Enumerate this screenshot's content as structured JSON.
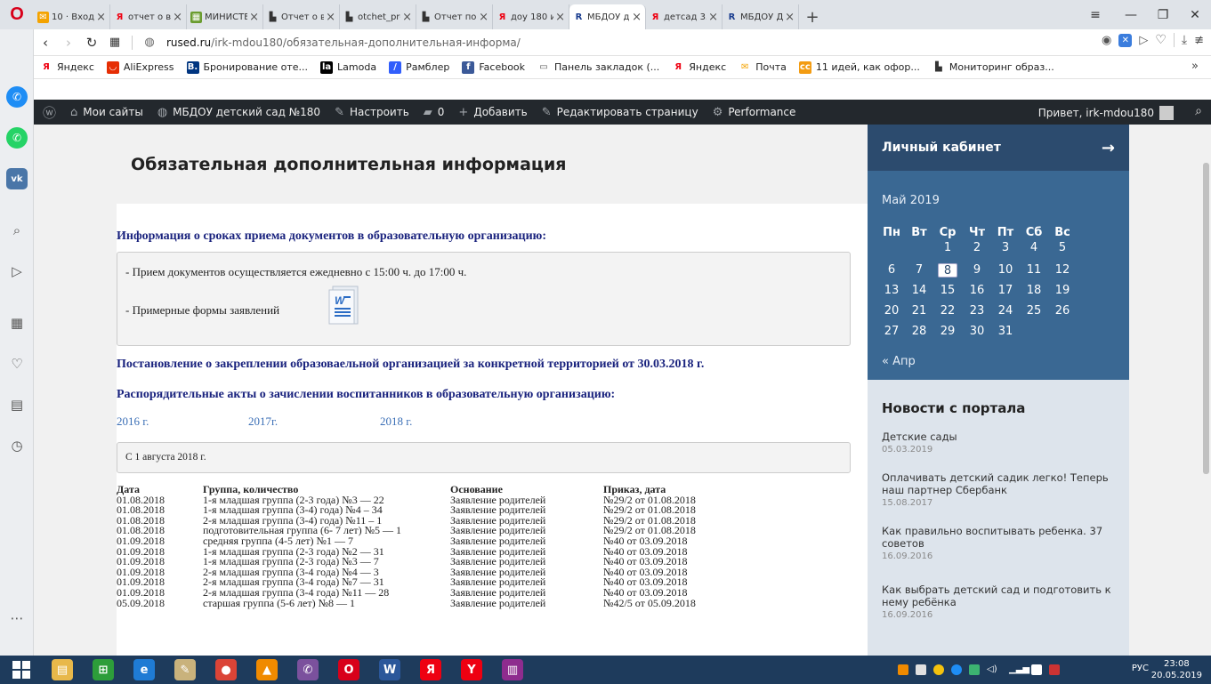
{
  "browser": {
    "logo": "O",
    "tabs": [
      {
        "title": "10 · Входя",
        "fav": "✉",
        "favColor": "#f4a300",
        "favText": "#fff"
      },
      {
        "title": "отчет о вь",
        "fav": "Я",
        "favColor": "transparent",
        "favText": "#e01"
      },
      {
        "title": "МИНИСТЕ",
        "fav": "▦",
        "favColor": "#6a9c2f",
        "favText": "#fff"
      },
      {
        "title": "Отчет о вь",
        "fav": "▙",
        "favColor": "transparent",
        "favText": "#333"
      },
      {
        "title": "otchet_pre",
        "fav": "▙",
        "favColor": "transparent",
        "favText": "#333"
      },
      {
        "title": "Отчет по",
        "fav": "▙",
        "favColor": "transparent",
        "favText": "#333"
      },
      {
        "title": "доу 180 и",
        "fav": "Я",
        "favColor": "transparent",
        "favText": "#e01"
      },
      {
        "title": "МБДОУ д",
        "fav": "R",
        "favColor": "transparent",
        "favText": "#1a3d8f"
      },
      {
        "title": "детсад 33",
        "fav": "Я",
        "favColor": "transparent",
        "favText": "#e01"
      },
      {
        "title": "МБДОУ Д",
        "fav": "R",
        "favColor": "transparent",
        "favText": "#1a3d8f"
      }
    ],
    "active_tab": 7,
    "new_tab": "+",
    "url_domain": "rused.ru",
    "url_path": "/irk-mdou180/обязательная-дополнительная-информа/",
    "bookmarks": [
      {
        "label": "Яндекс",
        "icon": "Я",
        "color": "#fff",
        "text": "#e01"
      },
      {
        "label": "AliExpress",
        "icon": "◡",
        "color": "#e62e04",
        "text": "#fff"
      },
      {
        "label": "Бронирование оте...",
        "icon": "B.",
        "color": "#003580",
        "text": "#fff"
      },
      {
        "label": "Lamoda",
        "icon": "la",
        "color": "#000",
        "text": "#fff"
      },
      {
        "label": "Рамблер",
        "icon": "/",
        "color": "#315efb",
        "text": "#fff"
      },
      {
        "label": "Facebook",
        "icon": "f",
        "color": "#3b5998",
        "text": "#fff"
      },
      {
        "label": "Панель закладок (...",
        "icon": "▭",
        "color": "#fff",
        "text": "#555"
      },
      {
        "label": "Яндекс",
        "icon": "Я",
        "color": "#fff",
        "text": "#e01"
      },
      {
        "label": "Почта",
        "icon": "✉",
        "color": "#fff",
        "text": "#f4a300"
      },
      {
        "label": "11 идей, как офор...",
        "icon": "cc",
        "color": "#f39c12",
        "text": "#fff"
      },
      {
        "label": "Мониторинг образ...",
        "icon": "▙",
        "color": "#fff",
        "text": "#333"
      }
    ],
    "bookmarks_more": "»"
  },
  "wpbar": {
    "items": [
      {
        "label": "Мои сайты",
        "icon": "⌂"
      },
      {
        "label": "МБДОУ детский сад №180",
        "icon": "◍"
      },
      {
        "label": "Настроить",
        "icon": "✎"
      },
      {
        "label": "0",
        "icon": "▰"
      },
      {
        "label": "Добавить",
        "icon": "+"
      },
      {
        "label": "Редактировать страницу",
        "icon": "✎"
      },
      {
        "label": "Performance",
        "icon": "⚙"
      }
    ],
    "greeting": "Привет, irk-mdou180"
  },
  "page": {
    "title": "Обязательная дополнительная информация",
    "h_terms": "Информация о сроках приема документов в образовательную организацию:",
    "terms_line1": "- Прием документов осуществляется ежедневно с 15:00 ч. до 17:00 ч.",
    "terms_line2": "- Примерные формы заявлений",
    "h_decree": "Постановление о закреплении образоваельной организацией за конкретной территорией от 30.03.2018 г.",
    "h_acts": "Распорядительные акты о зачислении воспитанников в образовательную организацию:",
    "years": [
      "2016 г.",
      "2017г.",
      "2018 г."
    ],
    "since": "С 1 августа 2018 г.",
    "table_headers": [
      "Дата",
      "Группа, количество",
      "Основание",
      "Приказ, дата"
    ],
    "rows": [
      [
        "01.08.2018",
        "1-я младшая группа (2-3 года) №3 — 22",
        "Заявление родителей",
        "№29/2 от 01.08.2018"
      ],
      [
        "01.08.2018",
        "1-я младшая группа (3-4) года) №4 – 34",
        "Заявление родителей",
        "№29/2 от 01.08.2018"
      ],
      [
        "01.08.2018",
        "2-я младшая группа (3-4) года) №11 – 1",
        "Заявление родителей",
        "№29/2 от 01.08.2018"
      ],
      [
        "01.08.2018",
        "подготовительная группа (6- 7 лет) №5 — 1",
        "Заявление родителей",
        "№29/2 от 01.08.2018"
      ],
      [
        "01.09.2018",
        "средняя группа (4-5 лет) №1 — 7",
        "Заявление родителей",
        "№40 от 03.09.2018"
      ],
      [
        "01.09.2018",
        "1-я младшая группа (2-3 года) №2 — 31",
        "Заявление родителей",
        "№40 от 03.09.2018"
      ],
      [
        "01.09.2018",
        "1-я младшая группа (2-3 года) №3 — 7",
        "Заявление родителей",
        "№40 от 03.09.2018"
      ],
      [
        "01.09.2018",
        "2-я младшая группа (3-4 года) №4 — 3",
        "Заявление родителей",
        "№40 от 03.09.2018"
      ],
      [
        "01.09.2018",
        "2-я младшая группа (3-4 года) №7 — 31",
        "Заявление родителей",
        "№40 от 03.09.2018"
      ],
      [
        "01.09.2018",
        "2-я младшая группа (3-4 года) №11 — 28",
        "Заявление родителей",
        "№40 от 03.09.2018"
      ],
      [
        "05.09.2018",
        "старшая группа (5-6 лет) №8 — 1",
        "Заявление родителей",
        "№42/5 от 05.09.2018"
      ]
    ]
  },
  "widget": {
    "cabinet": "Личный кабинет",
    "cabinet_arrow": "→",
    "month": "Май 2019",
    "dow": [
      "Пн",
      "Вт",
      "Ср",
      "Чт",
      "Пт",
      "Сб",
      "Вс"
    ],
    "first_weekday": 2,
    "days_in_month": 31,
    "today": 8,
    "prev": "« Апр",
    "news_title": "Новости с портала",
    "news": [
      {
        "title": "Детские сады",
        "date": "05.03.2019"
      },
      {
        "title": "Оплачивать детский садик легко! Теперь наш партнер Сбербанк",
        "date": "15.08.2017"
      },
      {
        "title": "Как правильно воспитывать ребенка. 37 советов",
        "date": "16.09.2016"
      },
      {
        "title": "Как выбрать детский сад и подготовить к нему ребёнка",
        "date": "16.09.2016"
      }
    ]
  },
  "taskbar": {
    "lang": "РУС",
    "time": "23:08",
    "date": "20.05.2019",
    "apps": [
      {
        "name": "explorer",
        "icon": "▤",
        "color": "#e8b84a"
      },
      {
        "name": "store",
        "icon": "⊞",
        "color": "#2d9d3a"
      },
      {
        "name": "ie",
        "icon": "e",
        "color": "#1f7bd4"
      },
      {
        "name": "paint",
        "icon": "✎",
        "color": "#c9b27c"
      },
      {
        "name": "chrome",
        "icon": "●",
        "color": "#db4437"
      },
      {
        "name": "vlc",
        "icon": "▲",
        "color": "#f08a00"
      },
      {
        "name": "viber",
        "icon": "✆",
        "color": "#7b519d"
      },
      {
        "name": "opera",
        "icon": "O",
        "color": "#d8001a"
      },
      {
        "name": "word",
        "icon": "W",
        "color": "#2b579a"
      },
      {
        "name": "yandex",
        "icon": "Я",
        "color": "#e01"
      },
      {
        "name": "yandex-browser",
        "icon": "Y",
        "color": "#e01"
      },
      {
        "name": "winrar",
        "icon": "▥",
        "color": "#8e2c8e"
      }
    ]
  }
}
